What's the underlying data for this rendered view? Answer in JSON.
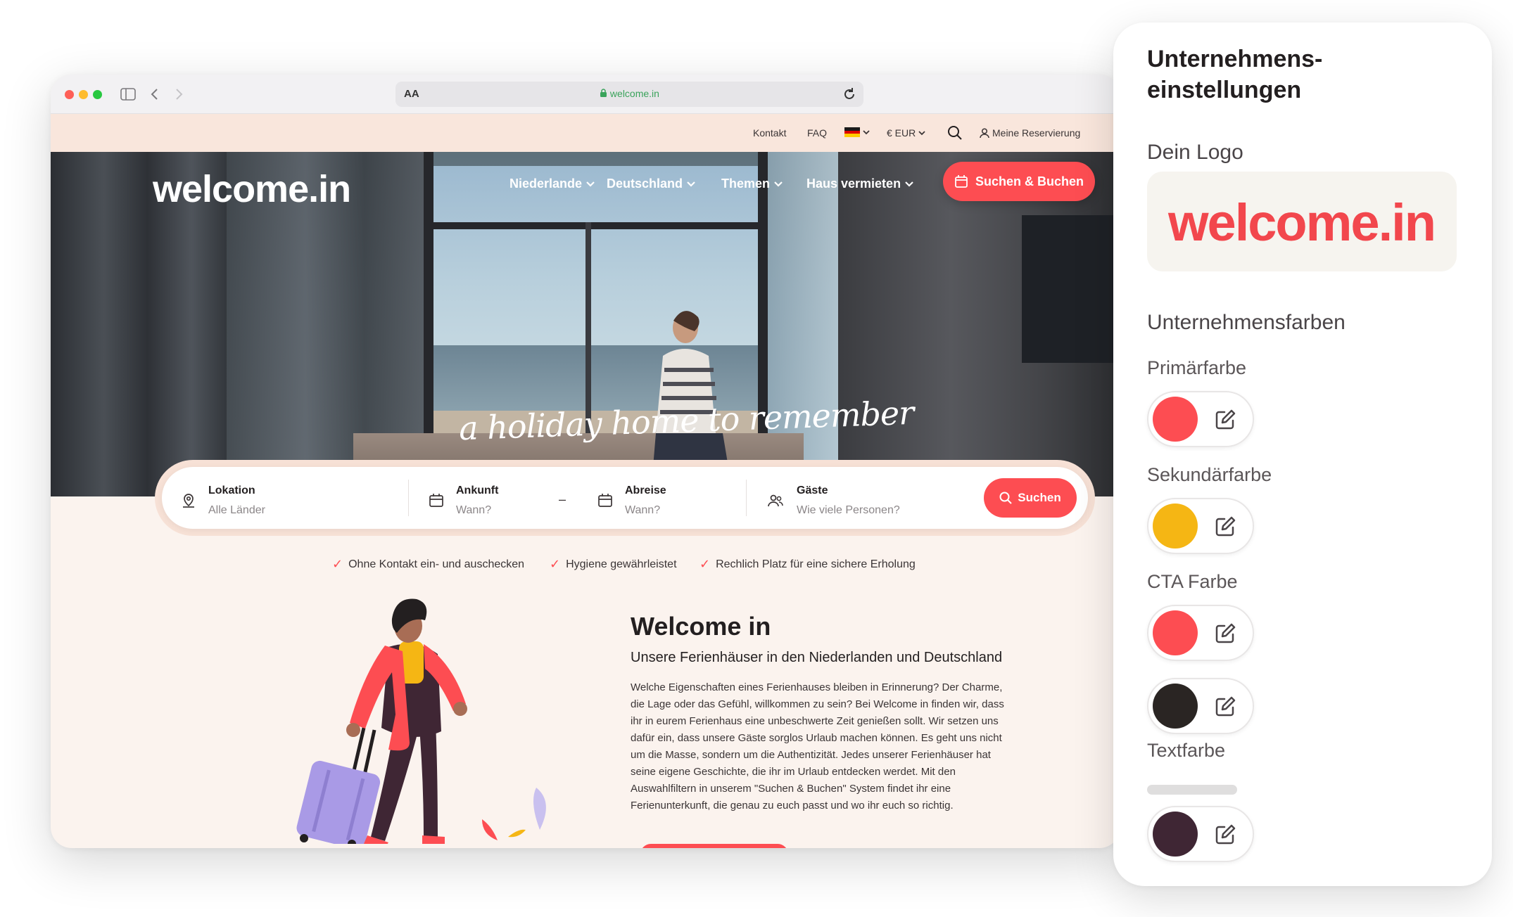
{
  "browser": {
    "url": "welcome.in",
    "reader_label": "AA"
  },
  "topbar": {
    "kontakt": "Kontakt",
    "faq": "FAQ",
    "currency": "€  EUR",
    "reservation": "Meine Reservierung"
  },
  "header": {
    "logo": "welcome.in",
    "nav": [
      "Niederlande",
      "Deutschland",
      "Themen",
      "Haus vermieten"
    ],
    "cta": "Suchen & Buchen",
    "tagline": "a holiday home to remember"
  },
  "search": {
    "location_label": "Lokation",
    "location_placeholder": "Alle Länder",
    "arrival_label": "Ankunft",
    "arrival_placeholder": "Wann?",
    "dash": "–",
    "departure_label": "Abreise",
    "departure_placeholder": "Wann?",
    "guests_label": "Gäste",
    "guests_placeholder": "Wie viele Personen?",
    "button": "Suchen"
  },
  "features": [
    "Ohne Kontakt ein- und auschecken",
    "Hygiene gewährleistet",
    "Rechlich Platz für eine sichere Erholung"
  ],
  "welcome": {
    "title": "Welcome in",
    "subtitle": "Unsere Ferienhäuser in den Niederlanden und Deutschland",
    "body": "Welche Eigenschaften eines Ferienhauses bleiben in Erinnerung? Der Charme, die Lage oder das Gefühl, willkommen zu sein? Bei Welcome in finden wir, dass ihr in eurem Ferienhaus eine unbeschwerte Zeit genießen sollt. Wir setzen uns dafür ein, dass unsere Gäste sorglos Urlaub machen können. Es geht uns nicht um die Masse, sondern um die Authentizität. Jedes unserer Ferienhäuser hat seine eigene Geschichte, die ihr im Urlaub entdecken werdet. Mit den Auswahlfiltern in unserem \"Suchen & Buchen\" System findet ihr eine Ferienunterkunft, die genau zu euch passt und wo ihr euch so richtig."
  },
  "panel": {
    "title": "Unternehmens-einstellungen",
    "logo_heading": "Dein Logo",
    "logo_text": "welcome.in",
    "colors_heading": "Unternehmensfarben",
    "primary_label": "Primärfarbe",
    "secondary_label": "Sekundärfarbe",
    "cta_label": "CTA Farbe",
    "text_label": "Textfarbe"
  },
  "colors": {
    "primary": "#fd4d52",
    "secondary": "#f5b614",
    "cta": "#fd4d52",
    "cta_text": "#2a2523",
    "text": "#3f2634",
    "background": "#fbf3ee"
  }
}
